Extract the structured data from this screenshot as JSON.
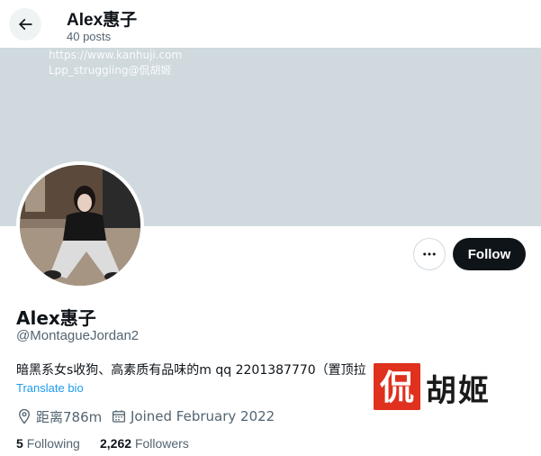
{
  "header": {
    "back_icon": "arrow-left-icon",
    "title": "Alex惠子",
    "post_count": "40 posts"
  },
  "watermark": {
    "url": "https://www.kanhuji.com",
    "credit": "Lpp_struggling@侃胡姬"
  },
  "banner": {
    "color": "#cfd9de"
  },
  "actions": {
    "more_icon": "more-dots-icon",
    "follow_label": "Follow"
  },
  "profile": {
    "display_name": "Alex惠子",
    "handle": "@MontagueJordan2",
    "bio": "暗黑系女s收狗、高素质有品味的m qq 2201387770（置顶拉",
    "translate_label": "Translate bio",
    "location": "距离786m",
    "location_icon": "location-pin-icon",
    "joined": "Joined February 2022",
    "joined_icon": "calendar-icon"
  },
  "stats": {
    "following_count": "5",
    "following_label": "Following",
    "followers_count": "2,262",
    "followers_label": "Followers"
  },
  "overlay": {
    "seal_text": "侃",
    "brand_text": "胡姬"
  },
  "colors": {
    "text_primary": "#0f1419",
    "text_secondary": "#536471",
    "link": "#1d9bf0",
    "follow_bg": "#0f1419",
    "seal_red": "#e0301e"
  }
}
